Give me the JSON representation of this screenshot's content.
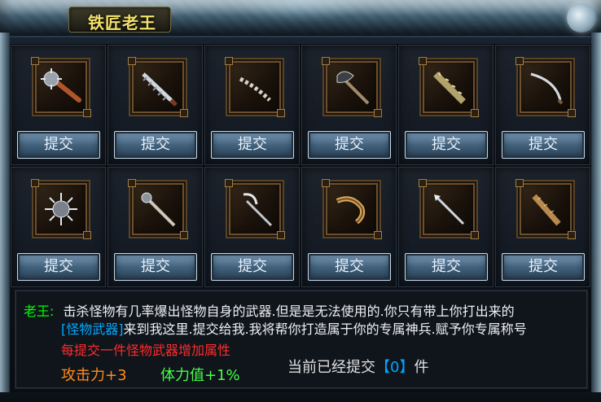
{
  "window": {
    "title": "铁匠老王"
  },
  "grid": {
    "items": [
      {
        "icon": "mace-icon",
        "button": "提交"
      },
      {
        "icon": "serrated-blade-icon",
        "button": "提交"
      },
      {
        "icon": "chain-whip-icon",
        "button": "提交"
      },
      {
        "icon": "axe-icon",
        "button": "提交"
      },
      {
        "icon": "thorn-club-icon",
        "button": "提交"
      },
      {
        "icon": "curved-sword-icon",
        "button": "提交"
      },
      {
        "icon": "spiked-ball-icon",
        "button": "提交"
      },
      {
        "icon": "staff-icon",
        "button": "提交"
      },
      {
        "icon": "scythe-icon",
        "button": "提交"
      },
      {
        "icon": "horn-blade-icon",
        "button": "提交"
      },
      {
        "icon": "spear-icon",
        "button": "提交"
      },
      {
        "icon": "bone-club-icon",
        "button": "提交"
      }
    ]
  },
  "desc": {
    "speaker": "老王:",
    "line1": "击杀怪物有几率爆出怪物自身的武器.但是是无法使用的.你只有带上你打出来的",
    "line2_tag": "[怪物武器]",
    "line2_rest": "来到我这里.提交给我.我将帮你打造属于你的专属神兵.赋予你专属称号",
    "bonus_title": "每提交一件怪物武器增加属性",
    "attack": "攻击力+3",
    "stamina": "体力值+1%",
    "count_prefix": "当前已经提交",
    "count_value": "【0】",
    "count_suffix": "件"
  }
}
